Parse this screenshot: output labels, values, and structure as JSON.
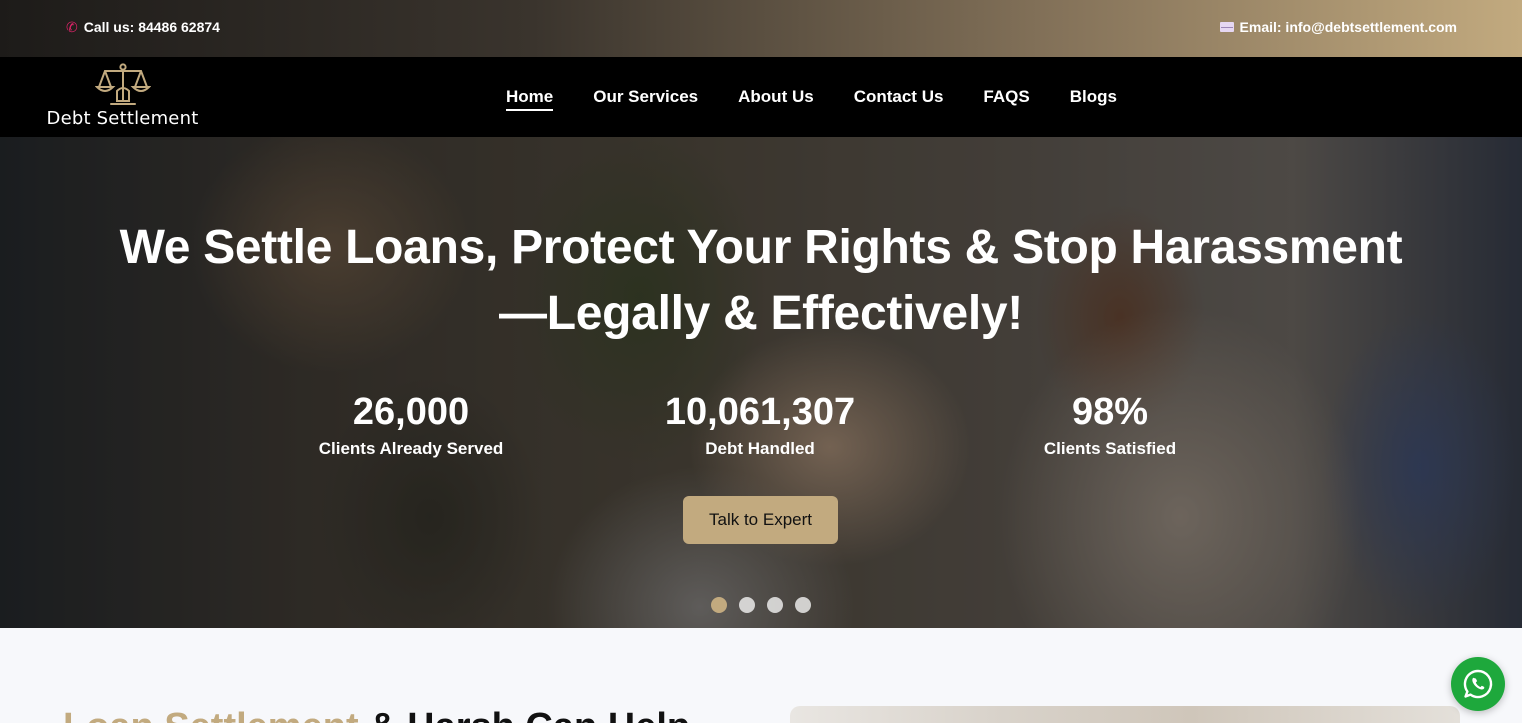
{
  "topbar": {
    "call_text": "Call us: 84486 62874",
    "email_text": "Email: info@debtsettlement.com"
  },
  "logo": {
    "text": "Debt Settlement"
  },
  "nav": {
    "items": [
      {
        "label": "Home",
        "active": true
      },
      {
        "label": "Our Services"
      },
      {
        "label": "About Us"
      },
      {
        "label": "Contact Us"
      },
      {
        "label": "FAQS"
      },
      {
        "label": "Blogs"
      }
    ]
  },
  "hero": {
    "title_line1": "We Settle Loans, Protect Your Rights & Stop Harassment",
    "title_line2": "—Legally & Effectively!",
    "stats": [
      {
        "value": "26,000",
        "label": "Clients Already Served"
      },
      {
        "value": "10,061,307",
        "label": "Debt Handled"
      },
      {
        "value": "98%",
        "label": "Clients Satisfied"
      }
    ],
    "cta_label": "Talk to Expert",
    "slides_count": 4,
    "active_slide": 1
  },
  "lower": {
    "heading_gold": "Loan Settlement",
    "heading_rest": " & Harsh Can Help"
  },
  "colors": {
    "accent_gold": "#c2aa7f",
    "phone_icon": "#e0246a",
    "whatsapp_green": "#1ea83c"
  },
  "icons": {
    "phone": "phone-icon",
    "email": "mail-icon",
    "logo": "scales-of-justice-icon",
    "whatsapp": "whatsapp-icon"
  }
}
